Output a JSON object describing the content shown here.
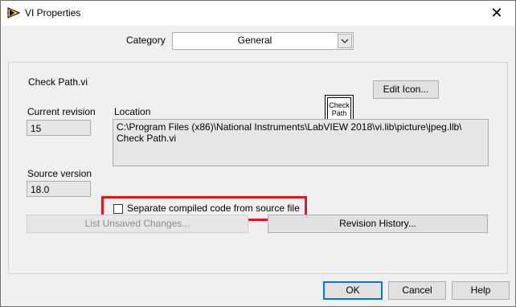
{
  "window": {
    "title": "VI Properties",
    "close_glyph": "✕"
  },
  "category": {
    "label": "Category",
    "value": "General"
  },
  "vi": {
    "name": "Check Path.vi",
    "icon_text_line1": "Check",
    "icon_text_line2": "Path"
  },
  "buttons": {
    "edit_icon": "Edit Icon...",
    "list_unsaved": "List Unsaved Changes...",
    "revision_history": "Revision History...",
    "ok": "OK",
    "cancel": "Cancel",
    "help": "Help"
  },
  "fields": {
    "current_revision_label": "Current revision",
    "current_revision_value": "15",
    "location_label": "Location",
    "location_value": "C:\\Program Files (x86)\\National Instruments\\LabVIEW 2018\\vi.lib\\picture\\jpeg.llb\\\nCheck Path.vi",
    "source_version_label": "Source version",
    "source_version_value": "18.0"
  },
  "checkbox": {
    "label": "Separate compiled code from source file",
    "checked": false
  },
  "colors": {
    "highlight": "#e1171e",
    "default_button_border": "#0078d7"
  },
  "icons": {
    "app": "labview-app-icon",
    "dropdown": "chevron-down-icon",
    "close": "close-icon"
  }
}
